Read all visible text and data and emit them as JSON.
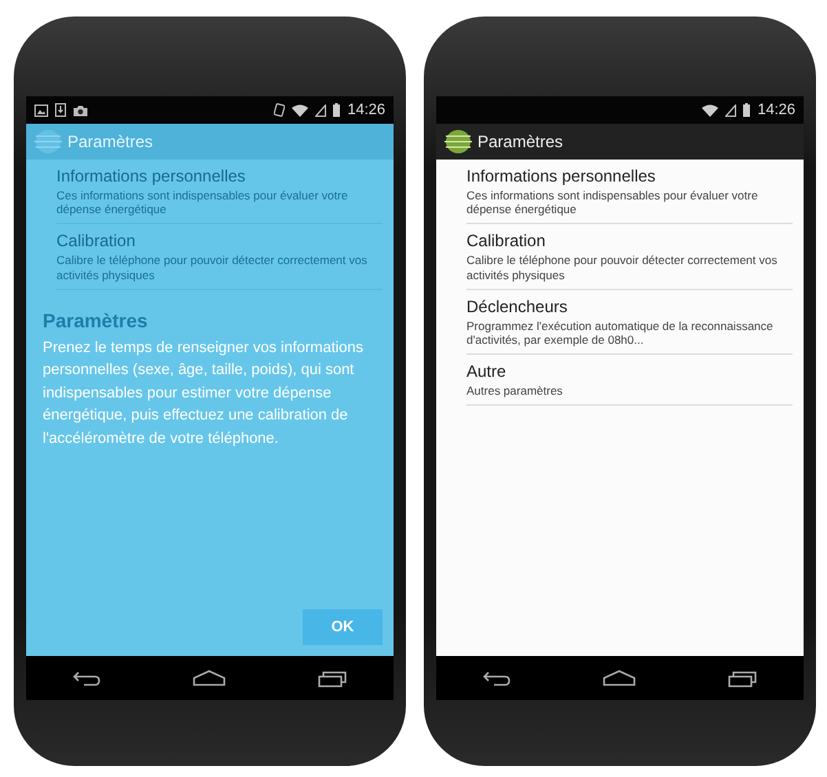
{
  "phones": [
    {
      "kind": "tutorial",
      "status_time": "14:26",
      "app_title": "Paramètres",
      "items": [
        {
          "title": "Informations personnelles",
          "subtitle": "Ces informations sont indispensables pour évaluer votre dépense énergétique"
        },
        {
          "title": "Calibration",
          "subtitle": "Calibre le téléphone pour pouvoir détecter correctement vos activités physiques"
        }
      ],
      "overlay": {
        "title": "Paramètres",
        "text": "Prenez le temps de renseigner vos informations personnelles (sexe, âge, taille, poids), qui sont indispensables pour estimer votre dépense énergétique, puis effectuez une calibration de l'accéléromètre de votre téléphone.",
        "button": "OK"
      }
    },
    {
      "kind": "plain",
      "status_time": "14:26",
      "app_title": "Paramètres",
      "items": [
        {
          "title": "Informations personnelles",
          "subtitle": "Ces informations sont indispensables pour évaluer votre dépense énergétique"
        },
        {
          "title": "Calibration",
          "subtitle": "Calibre le téléphone pour pouvoir détecter correctement vos activités physiques"
        },
        {
          "title": "Déclencheurs",
          "subtitle": "Programmez l'exécution automatique de la reconnaissance d'activités, par exemple de 08h0..."
        },
        {
          "title": "Autre",
          "subtitle": "Autres paramètres"
        }
      ]
    }
  ]
}
